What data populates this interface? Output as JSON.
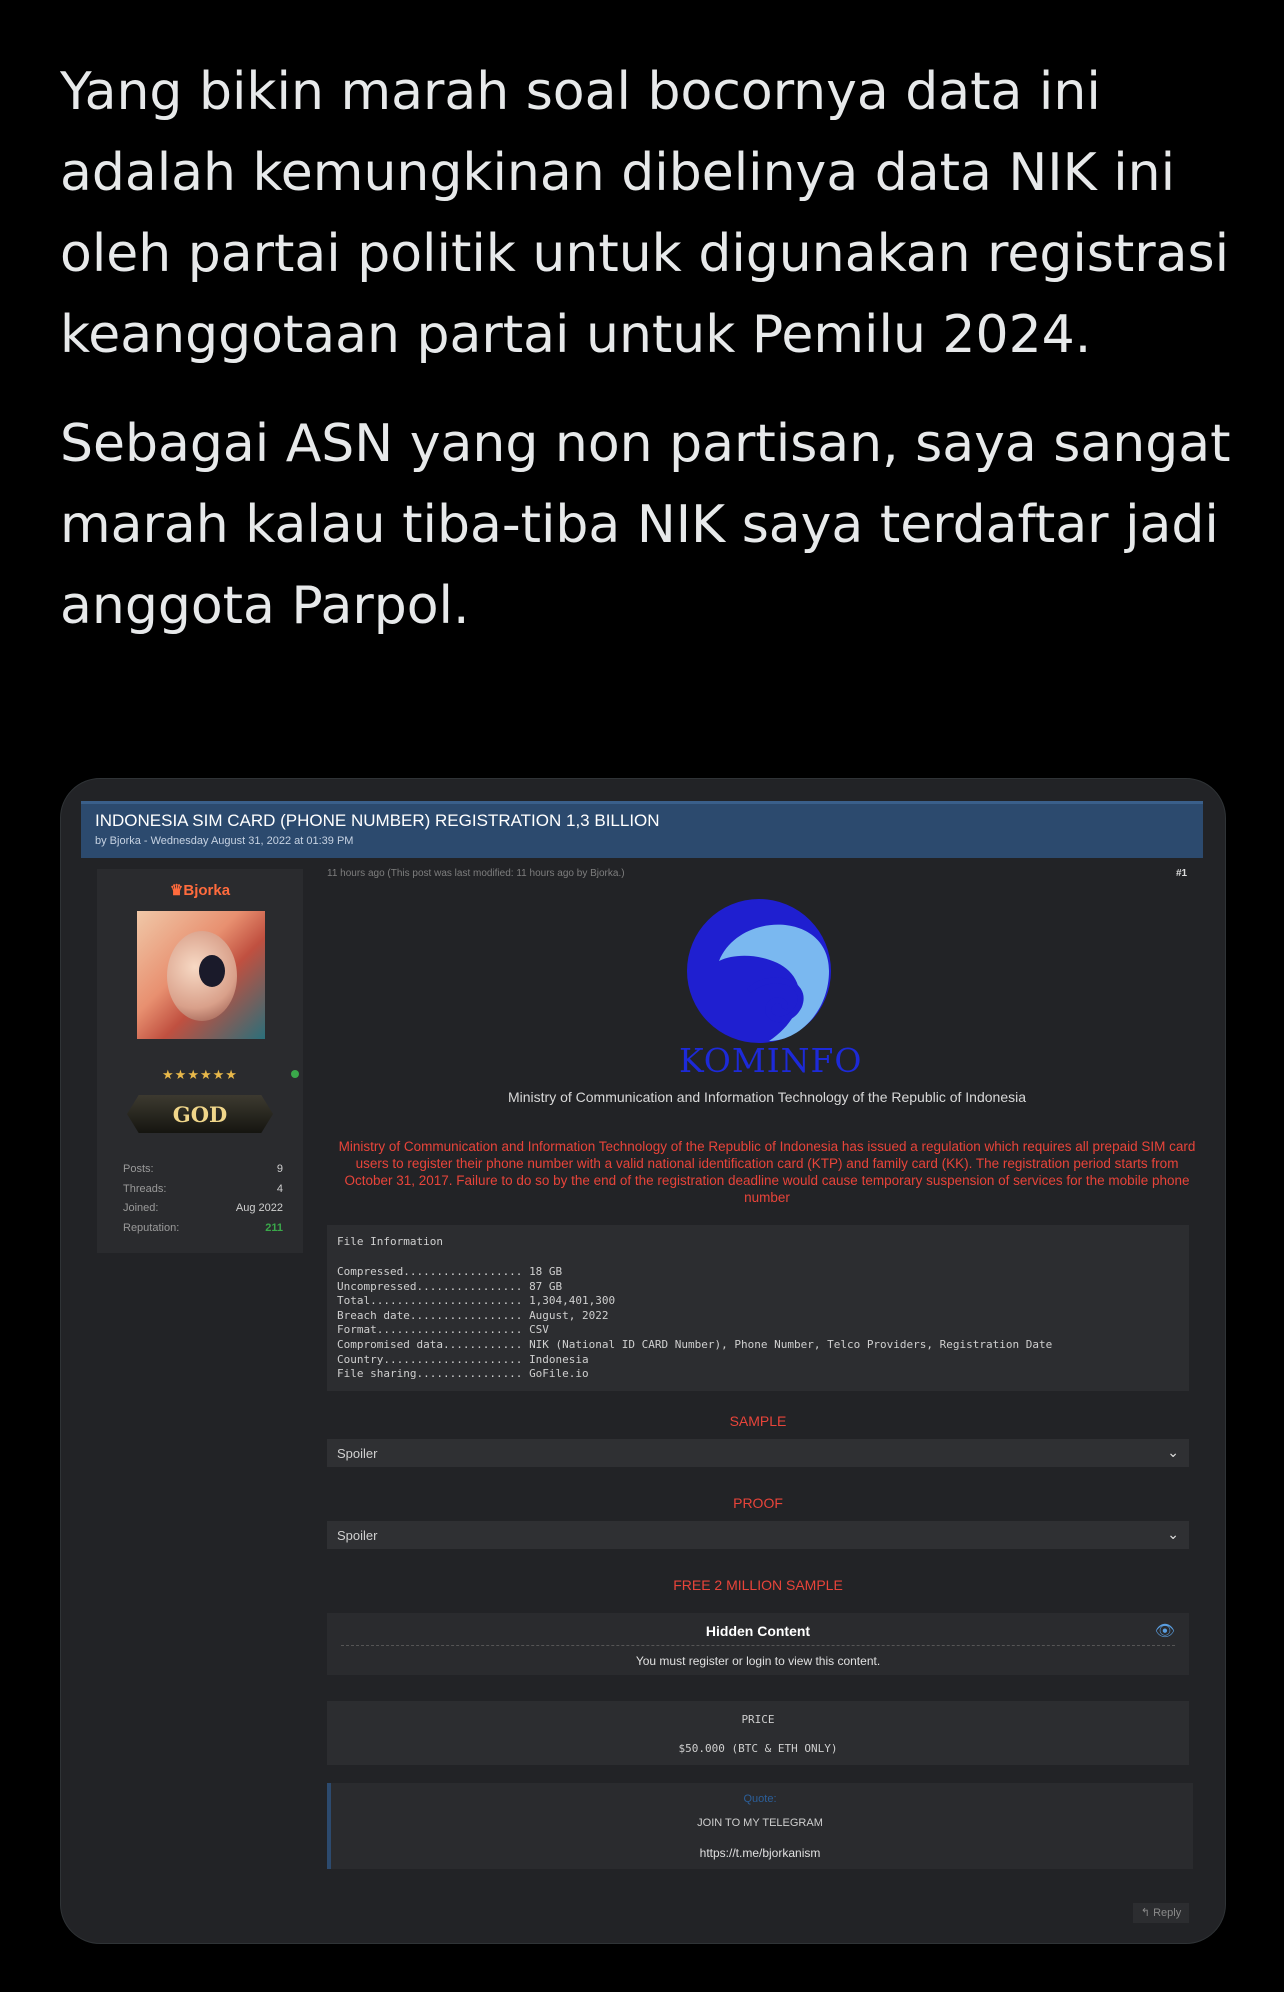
{
  "tweet": {
    "paragraph1": "Yang bikin marah soal bocornya data ini adalah kemungkinan dibelinya data NIK ini oleh partai politik untuk digunakan registrasi keanggotaan partai untuk Pemilu 2024.",
    "paragraph2": "Sebagai ASN yang non partisan, saya sangat marah kalau tiba-tiba NIK saya terdaftar jadi anggota Parpol."
  },
  "forum": {
    "thread_title": "INDONESIA SIM CARD (PHONE NUMBER) REGISTRATION 1,3 BILLION",
    "byline": "by Bjorka - Wednesday August 31, 2022 at 01:39 PM",
    "user": {
      "name": "Bjorka",
      "rank": "GOD",
      "stars": "★★★★★★",
      "stats": [
        {
          "label": "Posts:",
          "value": "9"
        },
        {
          "label": "Threads:",
          "value": "4"
        },
        {
          "label": "Joined:",
          "value": "Aug 2022"
        },
        {
          "label": "Reputation:",
          "value": "211"
        }
      ]
    },
    "post": {
      "meta": "11 hours ago  (This post was last modified: 11 hours ago by Bjorka.)",
      "number": "#1",
      "logo_text": "KOMINFO",
      "ministry": "Ministry of Communication and Information Technology of the Republic of Indonesia",
      "warning": "Ministry of Communication and Information Technology of the Republic of Indonesia has issued a regulation which requires all prepaid SIM card users to register their phone number with a valid national identification card (KTP) and family card (KK). The registration period starts from October 31, 2017. Failure to do so by the end of the registration deadline would cause temporary suspension of services for the mobile phone number",
      "file_info_header": "File Information",
      "file_info": [
        {
          "label": "Compressed..................",
          "value": "18 GB"
        },
        {
          "label": "Uncompressed................",
          "value": "87 GB"
        },
        {
          "label": "Total.......................",
          "value": "1,304,401,300"
        },
        {
          "label": "Breach date.................",
          "value": "August, 2022"
        },
        {
          "label": "Format......................",
          "value": "CSV"
        },
        {
          "label": "Compromised data............",
          "value": "NIK (National ID CARD Number), Phone Number, Telco Providers, Registration Date"
        },
        {
          "label": "Country.....................",
          "value": "Indonesia"
        },
        {
          "label": "File sharing................",
          "value": "GoFile.io"
        }
      ],
      "sample_heading": "SAMPLE",
      "spoiler1": "Spoiler",
      "proof_heading": "PROOF",
      "spoiler2": "Spoiler",
      "free_heading": "FREE 2 MILLION SAMPLE",
      "hidden_title": "Hidden Content",
      "hidden_msg": "You must register or login to view this content.",
      "price_label": "PRICE",
      "price_value": "$50.000 (BTC & ETH ONLY)",
      "quote_label": "Quote:",
      "quote_line1": "JOIN TO MY TELEGRAM",
      "quote_line2": "https://t.me/bjorkanism",
      "reply_label": "Reply"
    }
  },
  "colors": {
    "accent_red": "#e8443a",
    "header_blue": "#2c4a6e",
    "username": "#ff6b3d",
    "reputation_green": "#3aa84a"
  }
}
